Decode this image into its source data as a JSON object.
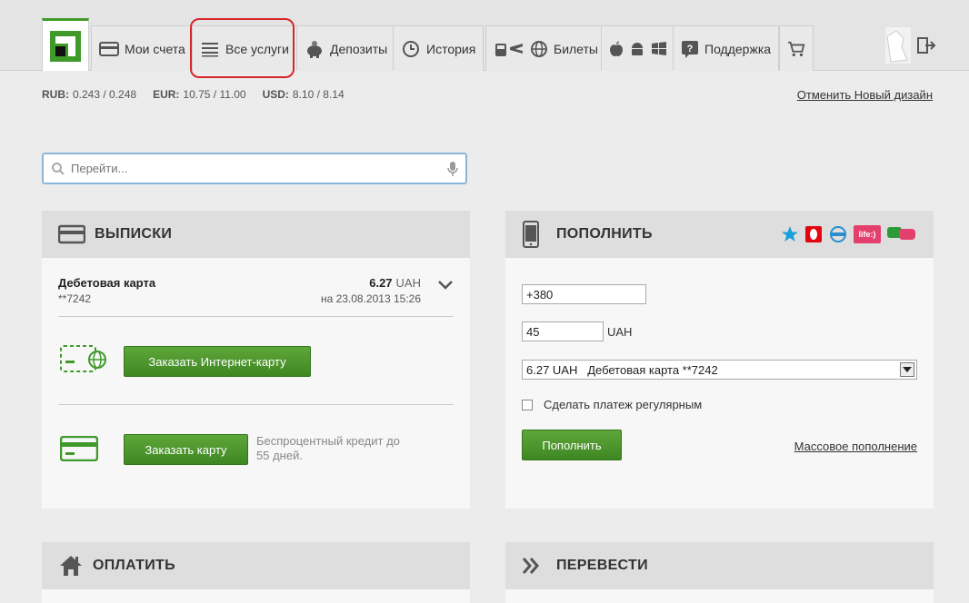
{
  "nav": {
    "tabs": [
      {
        "label": "Мои счета",
        "icon": "card-icon"
      },
      {
        "label": "Все услуги",
        "icon": "list-icon"
      },
      {
        "label": "Депозиты",
        "icon": "piggy-bank-icon"
      },
      {
        "label": "История",
        "icon": "history-icon"
      },
      {
        "label": "Билеты",
        "icon": "tickets-icon"
      },
      {
        "label": "",
        "icon": "apps-icon"
      },
      {
        "label": "Поддержка",
        "icon": "support-icon"
      },
      {
        "label": "",
        "icon": "cart-icon"
      }
    ]
  },
  "rates": {
    "rub": {
      "code": "RUB:",
      "value": "0.243 / 0.248"
    },
    "eur": {
      "code": "EUR:",
      "value": "10.75 / 11.00"
    },
    "usd": {
      "code": "USD:",
      "value": "8.10 / 8.14"
    }
  },
  "cancel_design_link": "Отменить Новый дизайн",
  "search": {
    "placeholder": "Перейти..."
  },
  "statements": {
    "title": "ВЫПИСКИ",
    "card": {
      "name": "Дебетовая карта",
      "number": "**7242",
      "amount": "6.27",
      "currency": "UAH",
      "date": "на 23.08.2013 15:26"
    },
    "internet_card_button": "Заказать Интернет-карту",
    "order_card_button": "Заказать карту",
    "credit_text": "Беспроцентный кредит до 55 дней."
  },
  "topup": {
    "title": "ПОПОЛНИТЬ",
    "phone_value": "+380",
    "amount_value": "45",
    "currency": "UAH",
    "source_selected": "6.27 UAH   Дебетовая карта **7242",
    "regular_label": "Сделать платеж регулярным",
    "submit_button": "Пополнить",
    "mass_link": "Массовое пополнение",
    "operators": {
      "life_label": "life:)"
    }
  },
  "pay": {
    "title": "ОПЛАТИТЬ"
  },
  "transfer": {
    "title": "ПЕРЕВЕСТИ"
  }
}
